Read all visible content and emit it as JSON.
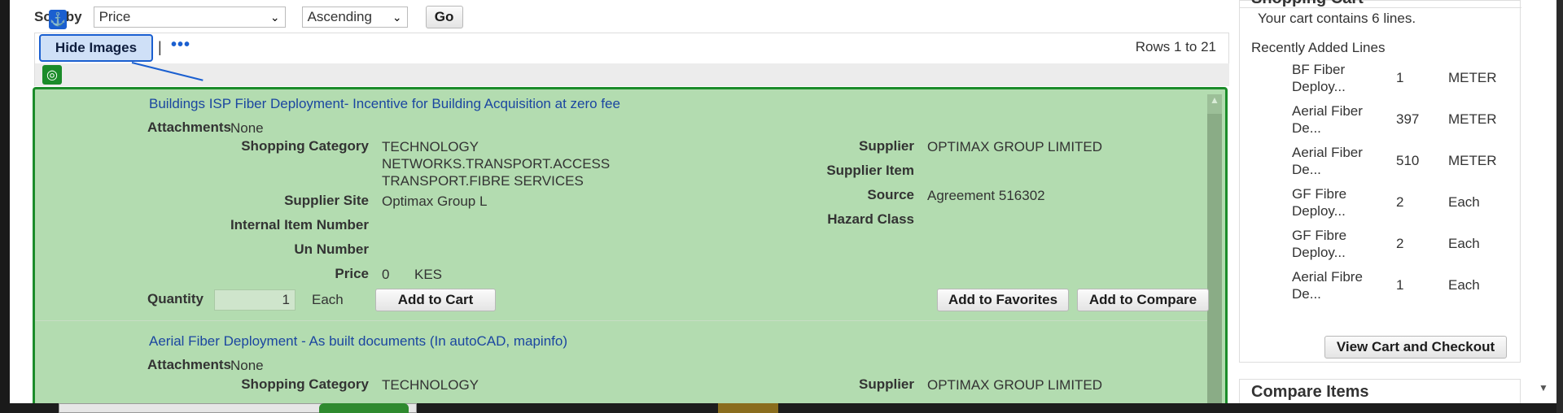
{
  "sort": {
    "label": "Sort by",
    "field_value": "Price",
    "order_value": "Ascending",
    "go_label": "Go"
  },
  "toolbar": {
    "hide_images_label": "Hide Images",
    "pipe": "|",
    "more": "•••",
    "rows_text": "Rows 1 to 21"
  },
  "icons": {
    "anchor": "⚓",
    "target": "◎",
    "chevron": "⌄",
    "scroll_up": "▲",
    "scroll_down": "▼"
  },
  "items": [
    {
      "title": "Buildings ISP Fiber Deployment- Incentive for Building Acquisition at zero fee",
      "attachments_label": "Attachments",
      "attachments_value": "None",
      "category_label": "Shopping Category",
      "category_lines": [
        "TECHNOLOGY",
        "NETWORKS.TRANSPORT.ACCESS",
        "TRANSPORT.FIBRE SERVICES"
      ],
      "supplier_site_label": "Supplier Site",
      "supplier_site_value": "Optimax Group L",
      "internal_item_label": "Internal Item Number",
      "un_number_label": "Un Number",
      "price_label": "Price",
      "price_value": "0",
      "currency": "KES",
      "supplier_label": "Supplier",
      "supplier_value": "OPTIMAX GROUP LIMITED",
      "supplier_item_label": "Supplier Item",
      "source_label": "Source",
      "source_value": "Agreement 516302",
      "hazard_label": "Hazard Class",
      "quantity_label": "Quantity",
      "quantity_value": "1",
      "uom": "Each",
      "add_cart": "Add to Cart",
      "add_fav": "Add to Favorites",
      "add_compare": "Add to Compare"
    },
    {
      "title": "Aerial Fiber Deployment - As built documents (In autoCAD, mapinfo)",
      "attachments_label": "Attachments",
      "attachments_value": "None",
      "category_label": "Shopping Category",
      "category_first": "TECHNOLOGY",
      "supplier_label": "Supplier",
      "supplier_value": "OPTIMAX GROUP LIMITED"
    }
  ],
  "cart": {
    "title": "Shopping Cart",
    "count_text": "Your cart contains 6 lines.",
    "recent_label": "Recently Added Lines",
    "lines": [
      {
        "name": "BF Fiber Deploy...",
        "qty": "1",
        "uom": "METER"
      },
      {
        "name": "Aerial Fiber De...",
        "qty": "397",
        "uom": "METER"
      },
      {
        "name": "Aerial Fiber De...",
        "qty": "510",
        "uom": "METER"
      },
      {
        "name": "GF Fibre Deploy...",
        "qty": "2",
        "uom": "Each"
      },
      {
        "name": "GF Fibre Deploy...",
        "qty": "2",
        "uom": "Each"
      },
      {
        "name": "Aerial Fibre De...",
        "qty": "1",
        "uom": "Each"
      }
    ],
    "view_cart_label": "View Cart and Checkout"
  },
  "compare": {
    "title": "Compare Items"
  }
}
